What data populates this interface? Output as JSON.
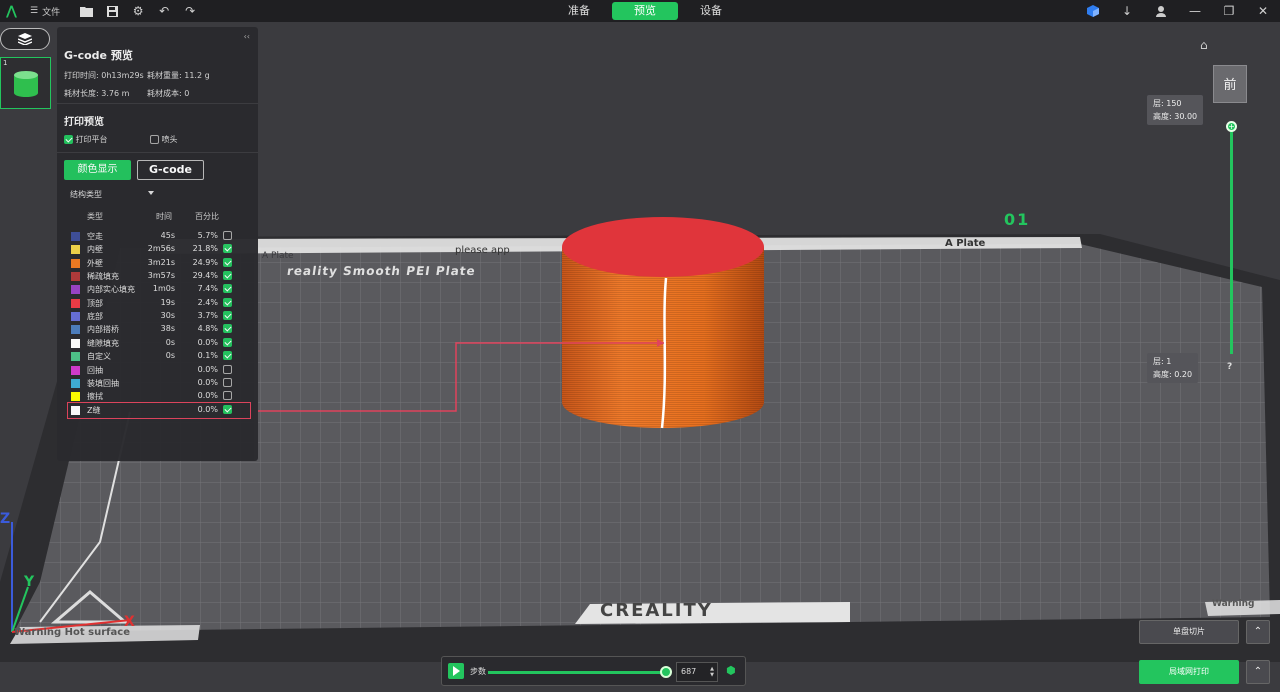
{
  "topbar": {
    "file_label": "文件",
    "tabs": [
      "准备",
      "预览",
      "设备"
    ],
    "active_tab_index": 1
  },
  "plate": {
    "number": "1"
  },
  "panel": {
    "title": "G-code 预览",
    "print_time": "打印时间: 0h13m29s",
    "filament_weight": "耗材重量: 11.2 g",
    "filament_length": "耗材长度: 3.76 m",
    "filament_cost": "耗材成本: 0",
    "section_title": "打印预览",
    "show_bed_label": "打印平台",
    "show_bed_checked": true,
    "show_nozzle_label": "喷头",
    "show_nozzle_checked": false,
    "color_display_label": "颜色显示",
    "gcode_label": "G-code",
    "structure_select": "结构类型",
    "columns": {
      "type": "类型",
      "time": "时间",
      "percent": "百分比"
    },
    "legend": [
      {
        "name": "空走",
        "time": "45s",
        "pct": "5.7%",
        "color": "#3f4f9a",
        "checked": false
      },
      {
        "name": "内壁",
        "time": "2m56s",
        "pct": "21.8%",
        "color": "#f2d44a",
        "checked": true
      },
      {
        "name": "外壁",
        "time": "3m21s",
        "pct": "24.9%",
        "color": "#ef7a22",
        "checked": true
      },
      {
        "name": "稀疏填充",
        "time": "3m57s",
        "pct": "29.4%",
        "color": "#b23a3a",
        "checked": true
      },
      {
        "name": "内部实心填充",
        "time": "1m0s",
        "pct": "7.4%",
        "color": "#9b44c8",
        "checked": true
      },
      {
        "name": "顶部",
        "time": "19s",
        "pct": "2.4%",
        "color": "#f03b46",
        "checked": true
      },
      {
        "name": "底部",
        "time": "30s",
        "pct": "3.7%",
        "color": "#6870d8",
        "checked": true
      },
      {
        "name": "内部搭桥",
        "time": "38s",
        "pct": "4.8%",
        "color": "#4d7fc0",
        "checked": true
      },
      {
        "name": "缝隙填充",
        "time": "0s",
        "pct": "0.0%",
        "color": "#ffffff",
        "checked": true
      },
      {
        "name": "自定义",
        "time": "0s",
        "pct": "0.1%",
        "color": "#4fc48a",
        "checked": true
      },
      {
        "name": "回抽",
        "time": "",
        "pct": "0.0%",
        "color": "#d53bd0",
        "checked": false
      },
      {
        "name": "装填回抽",
        "time": "",
        "pct": "0.0%",
        "color": "#3fb0d8",
        "checked": false
      },
      {
        "name": "擦拭",
        "time": "",
        "pct": "0.0%",
        "color": "#ffff00",
        "checked": false
      },
      {
        "name": "Z缝",
        "time": "",
        "pct": "0.0%",
        "color": "#ffffff",
        "checked": true
      }
    ]
  },
  "bed": {
    "brand": "CREALITY",
    "plate_text": "reality Smooth PEI Plate",
    "plate_label": "A Plate",
    "please_text": "please app",
    "warning_text": "Warning Hot surface",
    "warning_right": "Warning",
    "number": "01"
  },
  "axes": {
    "x": "X",
    "y": "Y",
    "z": "Z"
  },
  "view": {
    "cube_face": "前"
  },
  "layer_slider": {
    "top_layer": "层: 150",
    "top_height": "高度: 30.00",
    "bottom_layer": "层: 1",
    "bottom_height": "高度: 0.20",
    "help": "?"
  },
  "step_bar": {
    "label": "步数",
    "value": "687"
  },
  "actions": {
    "slice_plate": "单盘切片",
    "lan_print": "局域网打印"
  }
}
